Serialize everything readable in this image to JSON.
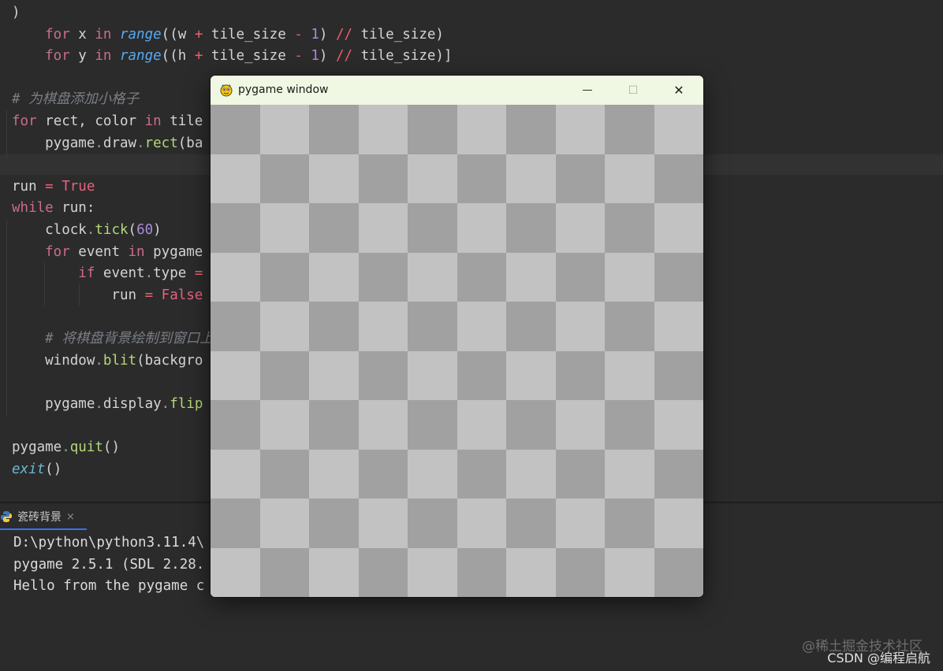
{
  "editor": {
    "lines": [
      {
        "segments": [
          {
            "t": ")",
            "c": "plain"
          }
        ]
      },
      {
        "segments": [
          {
            "t": "    for ",
            "c": "kw"
          },
          {
            "t": "x ",
            "c": "plain"
          },
          {
            "t": "in ",
            "c": "kw"
          },
          {
            "t": "range",
            "c": "fn"
          },
          {
            "t": "((w ",
            "c": "plain"
          },
          {
            "t": "+ ",
            "c": "op"
          },
          {
            "t": "tile_size ",
            "c": "plain"
          },
          {
            "t": "- ",
            "c": "op"
          },
          {
            "t": "1",
            "c": "num"
          },
          {
            "t": ") ",
            "c": "plain"
          },
          {
            "t": "// ",
            "c": "op"
          },
          {
            "t": "tile_size)",
            "c": "plain"
          }
        ]
      },
      {
        "segments": [
          {
            "t": "    for ",
            "c": "kw"
          },
          {
            "t": "y ",
            "c": "plain"
          },
          {
            "t": "in ",
            "c": "kw"
          },
          {
            "t": "range",
            "c": "fn"
          },
          {
            "t": "((h ",
            "c": "plain"
          },
          {
            "t": "+ ",
            "c": "op"
          },
          {
            "t": "tile_size ",
            "c": "plain"
          },
          {
            "t": "- ",
            "c": "op"
          },
          {
            "t": "1",
            "c": "num"
          },
          {
            "t": ") ",
            "c": "plain"
          },
          {
            "t": "// ",
            "c": "op"
          },
          {
            "t": "tile_size)]",
            "c": "plain"
          }
        ]
      },
      {
        "segments": []
      },
      {
        "segments": [
          {
            "t": "# 为棋盘添加小格子",
            "c": "cmt"
          }
        ]
      },
      {
        "segments": [
          {
            "t": "for ",
            "c": "kw"
          },
          {
            "t": "rect, color ",
            "c": "plain"
          },
          {
            "t": "in ",
            "c": "kw"
          },
          {
            "t": "tile",
            "c": "plain"
          }
        ]
      },
      {
        "segments": [
          {
            "t": "    pygame",
            "c": "plain"
          },
          {
            "t": ".",
            "c": "dim"
          },
          {
            "t": "draw",
            "c": "plain"
          },
          {
            "t": ".",
            "c": "dim"
          },
          {
            "t": "rect",
            "c": "attr"
          },
          {
            "t": "(ba",
            "c": "plain"
          }
        ]
      },
      {
        "segments": []
      },
      {
        "segments": [
          {
            "t": "run ",
            "c": "plain"
          },
          {
            "t": "= ",
            "c": "op"
          },
          {
            "t": "True",
            "c": "const"
          }
        ]
      },
      {
        "segments": [
          {
            "t": "while ",
            "c": "kw"
          },
          {
            "t": "run:",
            "c": "plain"
          }
        ]
      },
      {
        "segments": [
          {
            "t": "    clock",
            "c": "plain"
          },
          {
            "t": ".",
            "c": "dim"
          },
          {
            "t": "tick",
            "c": "attr"
          },
          {
            "t": "(",
            "c": "plain"
          },
          {
            "t": "60",
            "c": "num"
          },
          {
            "t": ")",
            "c": "plain"
          }
        ]
      },
      {
        "segments": [
          {
            "t": "    for ",
            "c": "kw"
          },
          {
            "t": "event ",
            "c": "plain"
          },
          {
            "t": "in ",
            "c": "kw"
          },
          {
            "t": "pygame",
            "c": "plain"
          }
        ]
      },
      {
        "segments": [
          {
            "t": "        if ",
            "c": "kw"
          },
          {
            "t": "event",
            "c": "plain"
          },
          {
            "t": ".",
            "c": "dim"
          },
          {
            "t": "type ",
            "c": "plain"
          },
          {
            "t": "=",
            "c": "op"
          }
        ]
      },
      {
        "segments": [
          {
            "t": "            run ",
            "c": "plain"
          },
          {
            "t": "= ",
            "c": "op"
          },
          {
            "t": "False",
            "c": "const"
          }
        ]
      },
      {
        "segments": []
      },
      {
        "segments": [
          {
            "t": "    # 将棋盘背景绘制到窗口上",
            "c": "cmt"
          }
        ]
      },
      {
        "segments": [
          {
            "t": "    window",
            "c": "plain"
          },
          {
            "t": ".",
            "c": "dim"
          },
          {
            "t": "blit",
            "c": "attr"
          },
          {
            "t": "(backgro",
            "c": "plain"
          }
        ]
      },
      {
        "segments": []
      },
      {
        "segments": [
          {
            "t": "    pygame",
            "c": "plain"
          },
          {
            "t": ".",
            "c": "dim"
          },
          {
            "t": "display",
            "c": "plain"
          },
          {
            "t": ".",
            "c": "dim"
          },
          {
            "t": "flip",
            "c": "attr"
          }
        ]
      },
      {
        "segments": []
      },
      {
        "segments": [
          {
            "t": "pygame",
            "c": "plain"
          },
          {
            "t": ".",
            "c": "dim"
          },
          {
            "t": "quit",
            "c": "attr"
          },
          {
            "t": "()",
            "c": "plain"
          }
        ]
      },
      {
        "segments": [
          {
            "t": "exit",
            "c": "builtin"
          },
          {
            "t": "()",
            "c": "plain"
          }
        ]
      }
    ]
  },
  "run_panel": {
    "tab_label": "瓷砖背景",
    "tab_close": "×",
    "console_lines": [
      "D:\\python\\python3.11.4\\",
      "pygame 2.5.1 (SDL 2.28.",
      "Hello from the pygame c"
    ]
  },
  "pygame_window": {
    "title": "pygame window",
    "minimize_glyph": "—",
    "maximize_glyph": "☐",
    "close_glyph": "✕",
    "board": {
      "columns": 10,
      "rows": 10,
      "color_a": "#a1a1a1",
      "color_b": "#c2c2c2"
    }
  },
  "watermarks": {
    "juejin": "@稀土掘金技术社区",
    "csdn": "CSDN @编程启航"
  }
}
